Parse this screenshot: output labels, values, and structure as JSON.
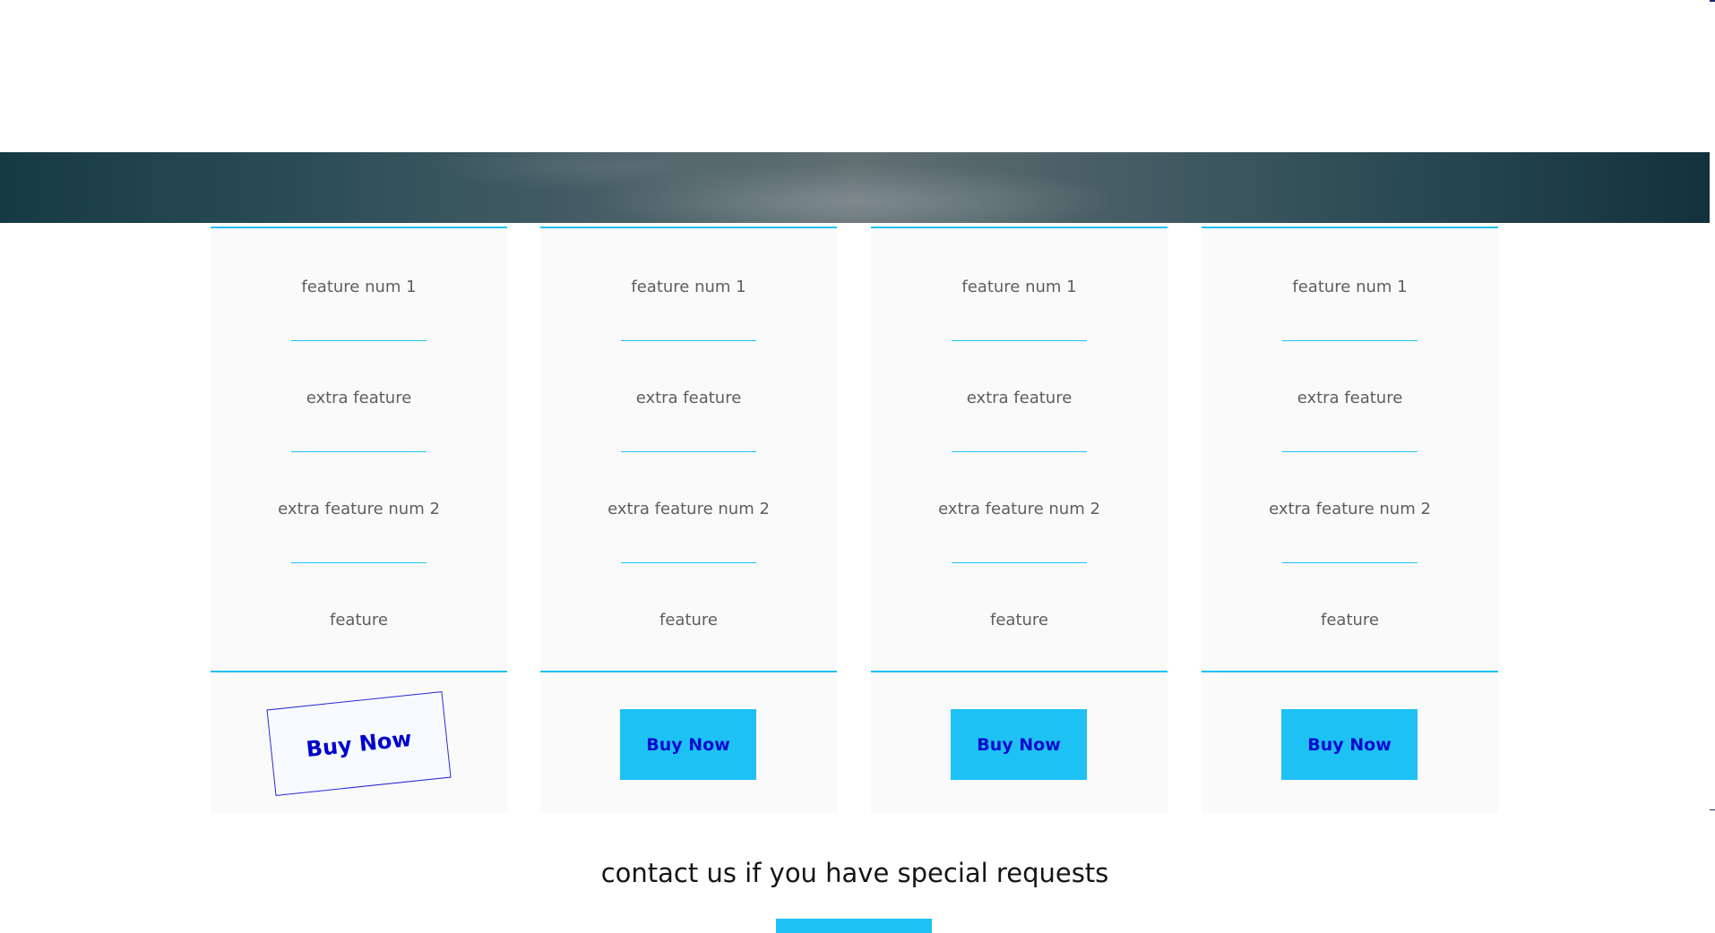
{
  "colors": {
    "accent": "#1ec1f4",
    "button_text": "#0b0bd0",
    "feature_text": "#5e5e5e",
    "card_background": "#fafafa"
  },
  "plans": [
    {
      "features": [
        "feature num 1",
        "extra feature",
        "extra feature num 2",
        "feature"
      ],
      "buy_label": "Buy Now"
    },
    {
      "features": [
        "feature num 1",
        "extra feature",
        "extra feature num 2",
        "feature"
      ],
      "buy_label": "Buy Now"
    },
    {
      "features": [
        "feature num 1",
        "extra feature",
        "extra feature num 2",
        "feature"
      ],
      "buy_label": "Buy Now"
    },
    {
      "features": [
        "feature num 1",
        "extra feature",
        "extra feature num 2",
        "feature"
      ],
      "buy_label": "Buy Now"
    }
  ],
  "contact": {
    "heading": "contact us if you have special requests"
  }
}
